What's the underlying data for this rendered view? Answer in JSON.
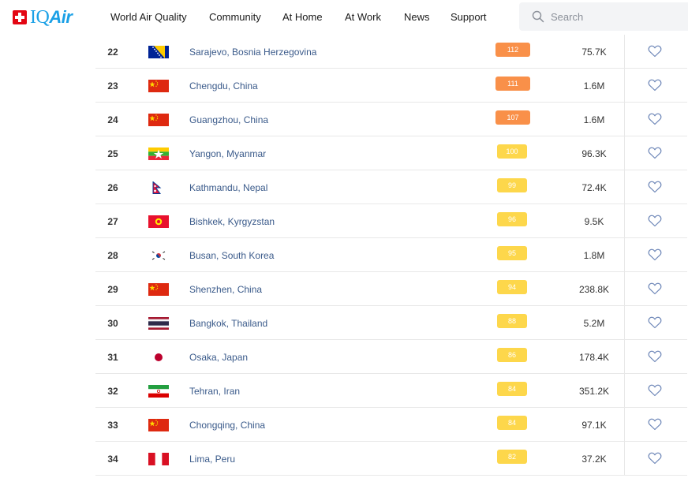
{
  "header": {
    "logo_text_iq": "IQ",
    "logo_text_air": "Air",
    "nav": [
      "World Air Quality",
      "Community",
      "At Home",
      "At Work",
      "News",
      "Support"
    ],
    "search_placeholder": "Search"
  },
  "colors": {
    "brand": "#1aa0e6",
    "aqi_unhealthy_sensitive": "#f99049",
    "aqi_moderate": "#fdd74b",
    "city_link": "#3a5a8a"
  },
  "rows": [
    {
      "rank": "22",
      "flag": "bosnia",
      "city": "Sarajevo, Bosnia Herzegovina",
      "aqi": "112",
      "level": "orange",
      "population": "75.7K"
    },
    {
      "rank": "23",
      "flag": "china",
      "city": "Chengdu, China",
      "aqi": "111",
      "level": "orange",
      "population": "1.6M"
    },
    {
      "rank": "24",
      "flag": "china",
      "city": "Guangzhou, China",
      "aqi": "107",
      "level": "orange",
      "population": "1.6M"
    },
    {
      "rank": "25",
      "flag": "myanmar",
      "city": "Yangon, Myanmar",
      "aqi": "100",
      "level": "yellow",
      "population": "96.3K"
    },
    {
      "rank": "26",
      "flag": "nepal",
      "city": "Kathmandu, Nepal",
      "aqi": "99",
      "level": "yellow",
      "population": "72.4K"
    },
    {
      "rank": "27",
      "flag": "kyrgyzstan",
      "city": "Bishkek, Kyrgyzstan",
      "aqi": "96",
      "level": "yellow",
      "population": "9.5K"
    },
    {
      "rank": "28",
      "flag": "south-korea",
      "city": "Busan, South Korea",
      "aqi": "95",
      "level": "yellow",
      "population": "1.8M"
    },
    {
      "rank": "29",
      "flag": "china",
      "city": "Shenzhen, China",
      "aqi": "94",
      "level": "yellow",
      "population": "238.8K"
    },
    {
      "rank": "30",
      "flag": "thailand",
      "city": "Bangkok, Thailand",
      "aqi": "88",
      "level": "yellow",
      "population": "5.2M"
    },
    {
      "rank": "31",
      "flag": "japan",
      "city": "Osaka, Japan",
      "aqi": "86",
      "level": "yellow",
      "population": "178.4K"
    },
    {
      "rank": "32",
      "flag": "iran",
      "city": "Tehran, Iran",
      "aqi": "84",
      "level": "yellow",
      "population": "351.2K"
    },
    {
      "rank": "33",
      "flag": "china",
      "city": "Chongqing, China",
      "aqi": "84",
      "level": "yellow",
      "population": "97.1K"
    },
    {
      "rank": "34",
      "flag": "peru",
      "city": "Lima, Peru",
      "aqi": "82",
      "level": "yellow",
      "population": "37.2K"
    }
  ]
}
